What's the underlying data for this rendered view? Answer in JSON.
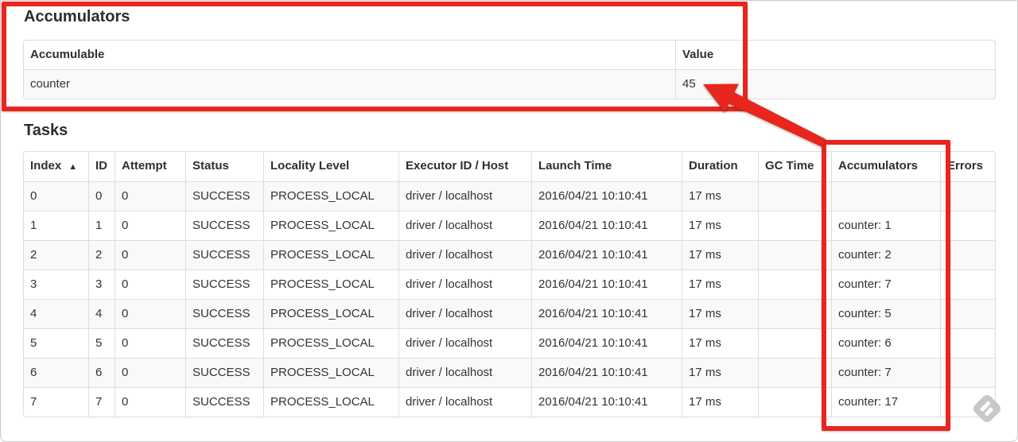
{
  "annotation_color": "#e8261d",
  "watermark_icon": "skitch-diamond",
  "accumulators": {
    "title": "Accumulators",
    "col_accumulable": "Accumulable",
    "col_value": "Value",
    "rows": [
      {
        "name": "counter",
        "value": "45"
      }
    ]
  },
  "tasks": {
    "title": "Tasks",
    "sort_icon": "▲",
    "columns": {
      "index": "Index",
      "id": "ID",
      "attempt": "Attempt",
      "status": "Status",
      "locality": "Locality Level",
      "executor": "Executor ID / Host",
      "launch": "Launch Time",
      "duration": "Duration",
      "gc": "GC Time",
      "accumulators": "Accumulators",
      "errors": "Errors"
    },
    "rows": [
      {
        "index": "0",
        "id": "0",
        "attempt": "0",
        "status": "SUCCESS",
        "locality": "PROCESS_LOCAL",
        "executor": "driver / localhost",
        "launch": "2016/04/21 10:10:41",
        "duration": "17 ms",
        "gc": "",
        "accumulators": "",
        "errors": ""
      },
      {
        "index": "1",
        "id": "1",
        "attempt": "0",
        "status": "SUCCESS",
        "locality": "PROCESS_LOCAL",
        "executor": "driver / localhost",
        "launch": "2016/04/21 10:10:41",
        "duration": "17 ms",
        "gc": "",
        "accumulators": "counter: 1",
        "errors": ""
      },
      {
        "index": "2",
        "id": "2",
        "attempt": "0",
        "status": "SUCCESS",
        "locality": "PROCESS_LOCAL",
        "executor": "driver / localhost",
        "launch": "2016/04/21 10:10:41",
        "duration": "17 ms",
        "gc": "",
        "accumulators": "counter: 2",
        "errors": ""
      },
      {
        "index": "3",
        "id": "3",
        "attempt": "0",
        "status": "SUCCESS",
        "locality": "PROCESS_LOCAL",
        "executor": "driver / localhost",
        "launch": "2016/04/21 10:10:41",
        "duration": "17 ms",
        "gc": "",
        "accumulators": "counter: 7",
        "errors": ""
      },
      {
        "index": "4",
        "id": "4",
        "attempt": "0",
        "status": "SUCCESS",
        "locality": "PROCESS_LOCAL",
        "executor": "driver / localhost",
        "launch": "2016/04/21 10:10:41",
        "duration": "17 ms",
        "gc": "",
        "accumulators": "counter: 5",
        "errors": ""
      },
      {
        "index": "5",
        "id": "5",
        "attempt": "0",
        "status": "SUCCESS",
        "locality": "PROCESS_LOCAL",
        "executor": "driver / localhost",
        "launch": "2016/04/21 10:10:41",
        "duration": "17 ms",
        "gc": "",
        "accumulators": "counter: 6",
        "errors": ""
      },
      {
        "index": "6",
        "id": "6",
        "attempt": "0",
        "status": "SUCCESS",
        "locality": "PROCESS_LOCAL",
        "executor": "driver / localhost",
        "launch": "2016/04/21 10:10:41",
        "duration": "17 ms",
        "gc": "",
        "accumulators": "counter: 7",
        "errors": ""
      },
      {
        "index": "7",
        "id": "7",
        "attempt": "0",
        "status": "SUCCESS",
        "locality": "PROCESS_LOCAL",
        "executor": "driver / localhost",
        "launch": "2016/04/21 10:10:41",
        "duration": "17 ms",
        "gc": "",
        "accumulators": "counter: 17",
        "errors": ""
      }
    ]
  }
}
